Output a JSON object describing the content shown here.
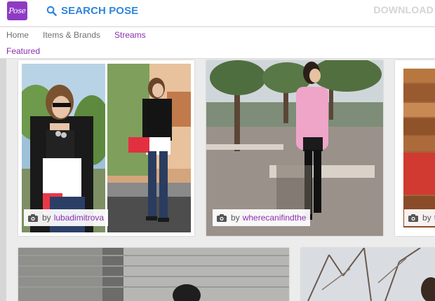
{
  "header": {
    "logo_text": "Pose",
    "search_label": "SEARCH POSE",
    "download_label": "DOWNLOAD"
  },
  "nav": {
    "items": [
      {
        "label": "Home"
      },
      {
        "label": "Items & Brands"
      },
      {
        "label": "Streams"
      }
    ],
    "active": "Streams"
  },
  "subnav": {
    "label": "Featured"
  },
  "feed": {
    "posts": [
      {
        "by": "by",
        "user": "lubadimitrova"
      },
      {
        "by": "by",
        "user": "wherecanifindthe"
      },
      {
        "by": "by",
        "user": "t"
      }
    ]
  },
  "colors": {
    "brand_purple": "#8e3bc4",
    "link_purple": "#8a2fb0",
    "search_blue": "#2f86dd",
    "download_gray": "#d4d4d4"
  },
  "icons": [
    "search-icon",
    "camera-icon"
  ]
}
